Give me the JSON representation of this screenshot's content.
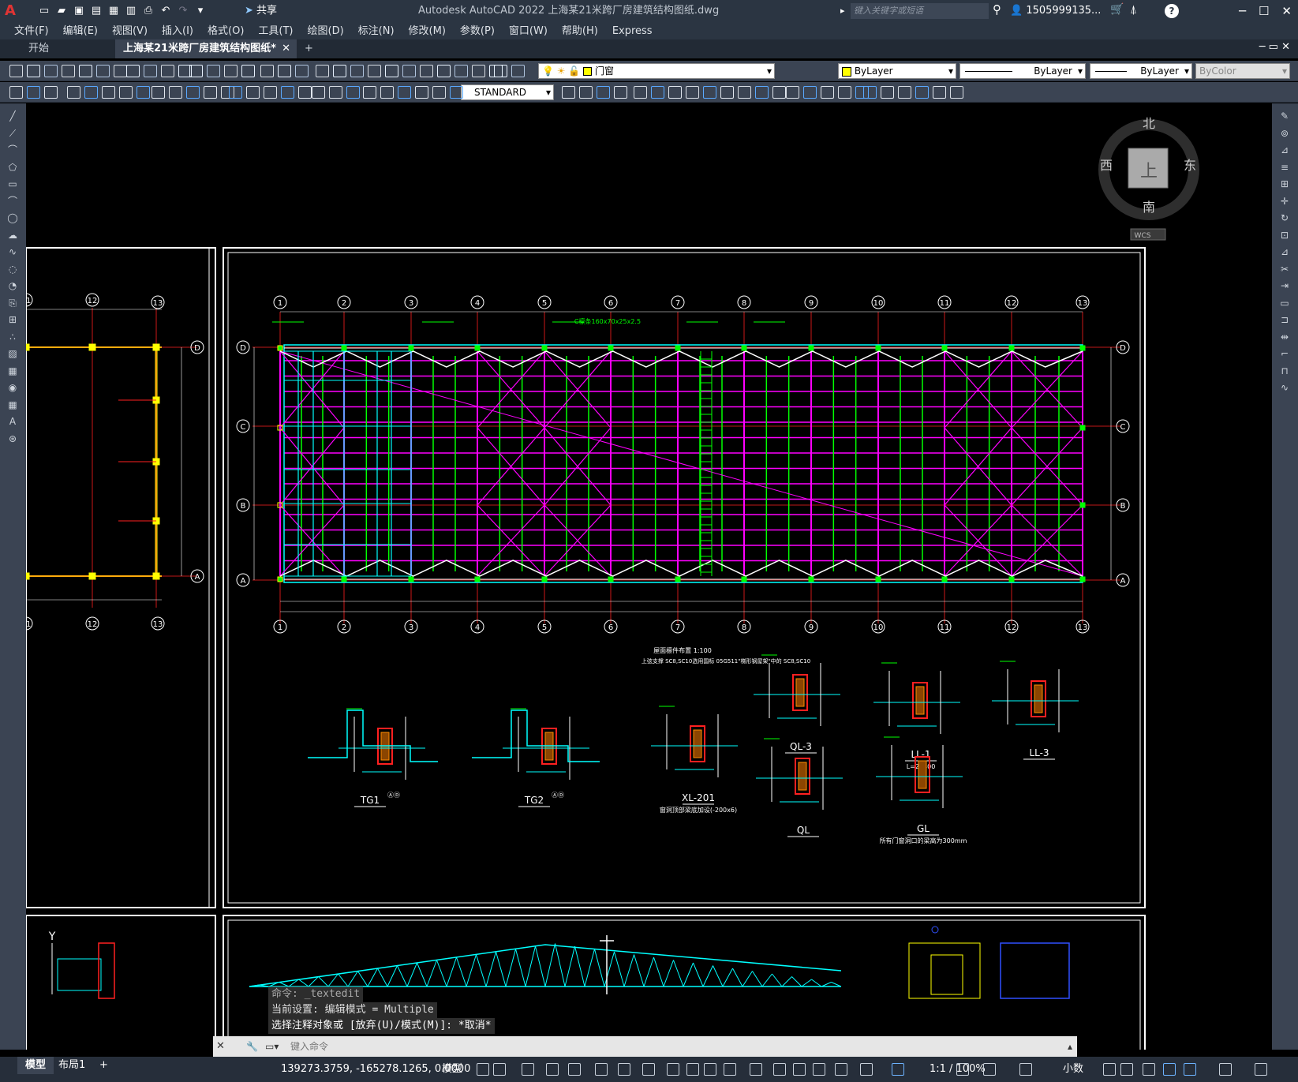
{
  "app": {
    "logo": "A",
    "title": "Autodesk AutoCAD 2022    上海某21米跨厂房建筑结构图纸.dwg",
    "share": "共享",
    "search_placeholder": "键入关键字或短语",
    "user": "1505999135...",
    "window": {
      "minimize": "─",
      "maximize": "☐",
      "close": "✕"
    }
  },
  "menu": [
    "文件(F)",
    "编辑(E)",
    "视图(V)",
    "插入(I)",
    "格式(O)",
    "工具(T)",
    "绘图(D)",
    "标注(N)",
    "修改(M)",
    "参数(P)",
    "窗口(W)",
    "帮助(H)",
    "Express"
  ],
  "tabs": {
    "start": "开始",
    "active": "上海某21米跨厂房建筑结构图纸*",
    "close": "✕",
    "add": "+"
  },
  "toolbar": {
    "layer": "门窗",
    "color": "ByLayer",
    "linetype": "ByLayer",
    "lineweight": "ByLayer",
    "plotstyle": "ByColor",
    "textstyle": "STANDARD"
  },
  "viewcube": {
    "north": "北",
    "south": "南",
    "east": "东",
    "west": "西",
    "face": "上",
    "wcs": "WCS"
  },
  "drawing": {
    "axis_numbers": [
      "①",
      "②",
      "③",
      "④",
      "⑤",
      "⑥",
      "⑦",
      "⑧",
      "⑨",
      "⑩",
      "⑪",
      "⑫",
      "⑬"
    ],
    "row_letters": [
      "Ⓓ",
      "Ⓒ",
      "Ⓑ",
      "Ⓐ"
    ],
    "left_numbers": [
      "①",
      "⑫",
      "⑬"
    ],
    "plan_title": "屋面檩件布置",
    "plan_scale": "1:100",
    "plan_note": "上弦支撑 SC8,SC10选用国标 05G511\"梯形钢屋架\"中的 SC8,SC10",
    "details": [
      {
        "label": "TG1",
        "sub": "ⒶⒹ"
      },
      {
        "label": "TG2",
        "sub": "ⒶⒹ"
      },
      {
        "label": "XL-201",
        "sub": "窗洞顶部梁底加设(-200x6)"
      },
      {
        "label": "QL-3",
        "sub": ""
      },
      {
        "label": "LL-1",
        "sub": "L=21400"
      },
      {
        "label": "LL-3",
        "sub": ""
      },
      {
        "label": "QL",
        "sub": ""
      },
      {
        "label": "GL",
        "sub": "所有门窗洞口的梁高为300mm"
      }
    ]
  },
  "command": {
    "history": [
      "命令: _textedit",
      "当前设置: 编辑模式 = Multiple",
      "选择注释对象或 [放弃(U)/模式(M)]: *取消*"
    ],
    "placeholder": "键入命令"
  },
  "layout_tabs": [
    "模型",
    "布局1",
    "+"
  ],
  "status": {
    "coords": "139273.3759, -165278.1265, 0.0000",
    "model": "模型",
    "scale": "1:1 / 100%",
    "units": "小数"
  }
}
